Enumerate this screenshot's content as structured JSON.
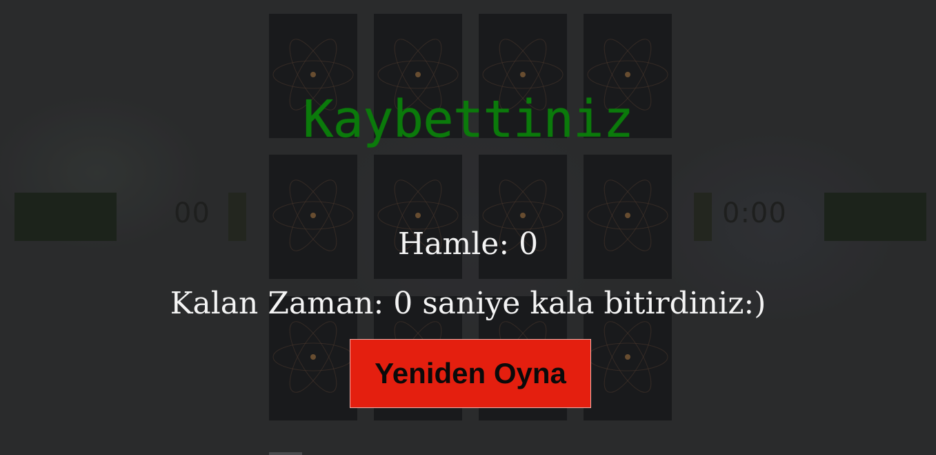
{
  "game": {
    "cards_count": 12,
    "card_back_icon": "atom-orbit-icon"
  },
  "left_panel": {
    "value": "00"
  },
  "right_panel": {
    "value": "0:00"
  },
  "result": {
    "title": "Kaybettiniz",
    "title_color": "#0b7a0b",
    "moves_text": "Hamle: 0",
    "remaining_text": "Kalan Zaman: 0 saniye kala bitirdiniz:)",
    "replay_label": "Yeniden Oyna",
    "replay_color": "#e41f0f"
  }
}
